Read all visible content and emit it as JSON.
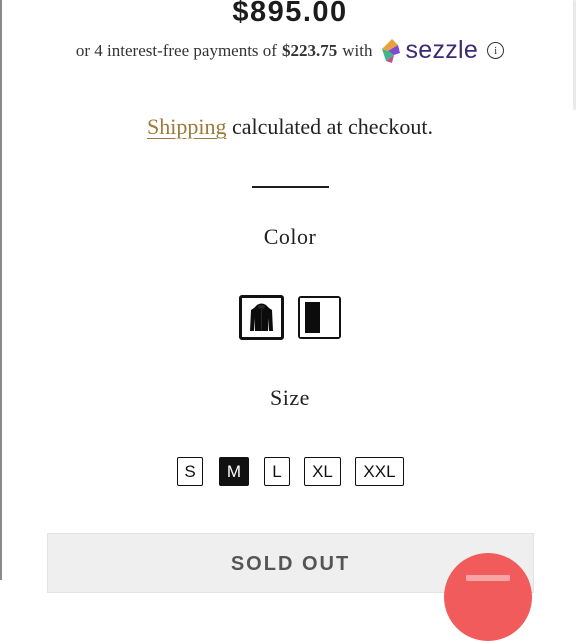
{
  "product": {
    "price": "$895.00",
    "installments": {
      "prefix": "or 4 interest-free payments of",
      "amount": "$223.75",
      "suffix": "with",
      "provider": "sezzle",
      "info_glyph": "i",
      "brand_colors": [
        "#e9a23b",
        "#3fb58d",
        "#7d4ad2",
        "#3c2a74"
      ]
    },
    "shipping": {
      "link_text": "Shipping",
      "rest_text": "calculated at checkout."
    },
    "color": {
      "label": "Color",
      "swatches": [
        {
          "name": "black-jacket",
          "selected": true
        },
        {
          "name": "black-white",
          "selected": false
        }
      ]
    },
    "size": {
      "label": "Size",
      "options": [
        "S",
        "M",
        "L",
        "XL",
        "XXL"
      ],
      "selected": "M"
    },
    "cta": {
      "label": "SOLD OUT",
      "disabled": true
    }
  },
  "theme": {
    "link_color": "#9b7a3b",
    "fab_color": "#f15b5b",
    "selected_size_bg": "#111111"
  },
  "icons": {
    "info": "info-icon",
    "sezzle": "sezzle-logo-icon",
    "fab": "chat-icon"
  }
}
